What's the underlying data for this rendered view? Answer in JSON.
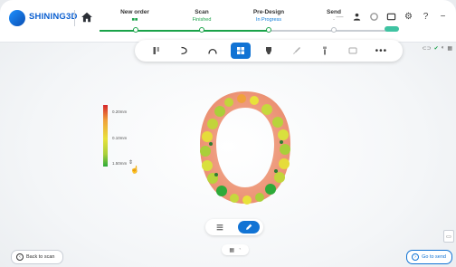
{
  "brand": {
    "name": "SHINING3D",
    "logo_icon": "shining3d-logo-icon",
    "accent": "#0b5fd0"
  },
  "header": {
    "home_icon": "home-icon",
    "steps": [
      {
        "name": "New order",
        "status": "■■",
        "state": "done"
      },
      {
        "name": "Scan",
        "status": "Finished",
        "state": "done"
      },
      {
        "name": "Pre-Design",
        "status": "In Progress",
        "state": "progress"
      },
      {
        "name": "Send",
        "status": "-",
        "state": "pending"
      }
    ],
    "right_icons": [
      "minimize-icon",
      "user-icon",
      "settings-wheel-icon",
      "gallery-icon",
      "gear-icon",
      "help-icon",
      "dash-icon"
    ]
  },
  "toolbar": {
    "tools": [
      "margin-line-icon",
      "curve-icon",
      "arch-icon",
      "grid-layout-icon",
      "tooth-icon",
      "brush-icon",
      "implant-icon",
      "scan-body-icon"
    ],
    "active_index": 3,
    "more_label": "•••"
  },
  "colorbar": {
    "labels": [
      "0.20mm",
      "0.10mm",
      "1.50mm"
    ],
    "colors": [
      "#d6262b",
      "#e8e23a",
      "#2eaa39"
    ]
  },
  "view_toggle": {
    "options": [
      "list-view-icon",
      "edit-view-icon"
    ],
    "active_index": 1
  },
  "footer": {
    "back_label": "Back to scan",
    "next_label": "Go to send"
  },
  "colors": {
    "primary": "#1173d4",
    "success": "#1ba34a",
    "progress_line_grey": "#c8cdd3"
  }
}
